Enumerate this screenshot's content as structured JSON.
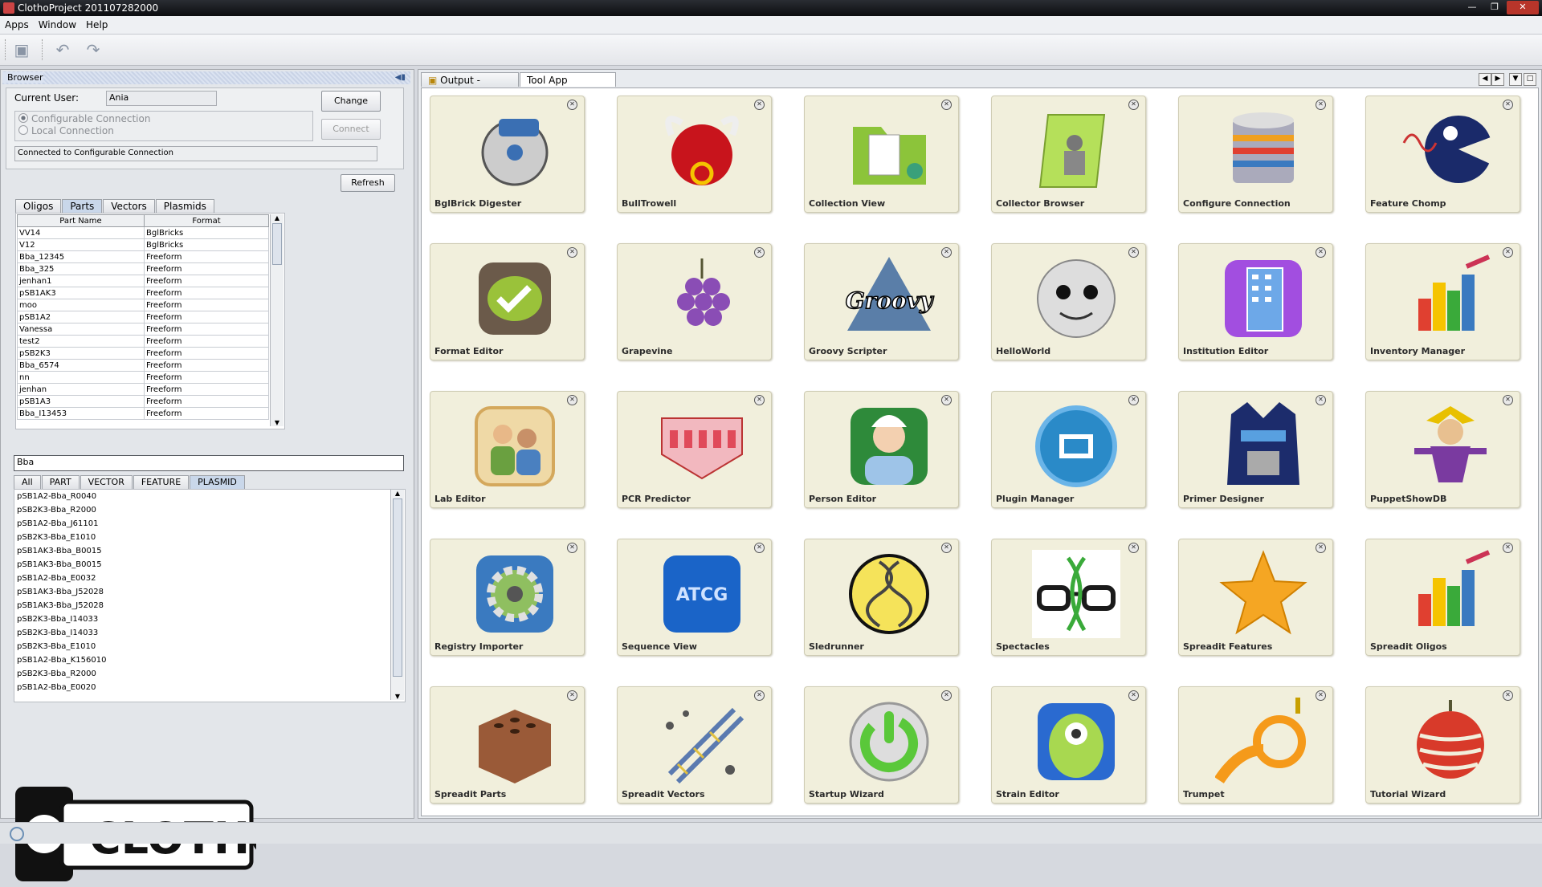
{
  "window": {
    "title": "ClothoProject 201107282000"
  },
  "menu": [
    "Apps",
    "Window",
    "Help"
  ],
  "browser": {
    "title": "Browser",
    "current_user_label": "Current User:",
    "current_user": "Ania",
    "change_label": "Change",
    "connect_label": "Connect",
    "radio_configurable": "Configurable Connection",
    "radio_local": "Local Connection",
    "status": "Connected to Configurable Connection",
    "refresh_label": "Refresh",
    "tabs": [
      "Oligos",
      "Parts",
      "Vectors",
      "Plasmids"
    ],
    "selected_tab": "Parts",
    "table": {
      "headers": [
        "Part Name",
        "Format"
      ],
      "rows": [
        [
          "VV14",
          "BglBricks"
        ],
        [
          "V12",
          "BglBricks"
        ],
        [
          "Bba_12345",
          "Freeform"
        ],
        [
          "Bba_325",
          "Freeform"
        ],
        [
          "jenhan1",
          "Freeform"
        ],
        [
          "pSB1AK3",
          "Freeform"
        ],
        [
          "moo",
          "Freeform"
        ],
        [
          "pSB1A2",
          "Freeform"
        ],
        [
          "Vanessa",
          "Freeform"
        ],
        [
          "test2",
          "Freeform"
        ],
        [
          "pSB2K3",
          "Freeform"
        ],
        [
          "Bba_6574",
          "Freeform"
        ],
        [
          "nn",
          "Freeform"
        ],
        [
          "jenhan",
          "Freeform"
        ],
        [
          "pSB1A3",
          "Freeform"
        ],
        [
          "Bba_I13453",
          "Freeform"
        ]
      ]
    },
    "search_value": "Bba",
    "filter_tabs": [
      "All",
      "PART",
      "VECTOR",
      "FEATURE",
      "PLASMID"
    ],
    "selected_filter": "PLASMID",
    "results": [
      "pSB1A2-Bba_R0040",
      "pSB2K3-Bba_R2000",
      "pSB1A2-Bba_J61101",
      "pSB2K3-Bba_E1010",
      "pSB1AK3-Bba_B0015",
      "pSB1AK3-Bba_B0015",
      "pSB1A2-Bba_E0032",
      "pSB1AK3-Bba_J52028",
      "pSB1AK3-Bba_J52028",
      "pSB2K3-Bba_I14033",
      "pSB2K3-Bba_I14033",
      "pSB2K3-Bba_E1010",
      "pSB1A2-Bba_K156010",
      "pSB2K3-Bba_R2000",
      "pSB1A2-Bba_E0020"
    ],
    "logo_text": "CLOTHO"
  },
  "doc_tabs": [
    {
      "label": "Output - out",
      "selected": false
    },
    {
      "label": "Tool App Browser",
      "selected": true
    }
  ],
  "apps": [
    {
      "name": "BglBrick Digester",
      "icon": "saw-icon",
      "color": "#3a6fb3"
    },
    {
      "name": "BullTrowell",
      "icon": "bull-icon",
      "color": "#c8141c"
    },
    {
      "name": "Collection View",
      "icon": "folder-icon",
      "color": "#8cc43a"
    },
    {
      "name": "Collector Browser",
      "icon": "collector-icon",
      "color": "#b5e05a"
    },
    {
      "name": "Configure Connection",
      "icon": "database-icon",
      "color": "#f0a020"
    },
    {
      "name": "Feature Chomp",
      "icon": "chomp-icon",
      "color": "#1a2a6a"
    },
    {
      "name": "Format Editor",
      "icon": "format-icon",
      "color": "#9ac23a"
    },
    {
      "name": "Grapevine",
      "icon": "grapes-icon",
      "color": "#8a4db5"
    },
    {
      "name": "Groovy Scripter",
      "icon": "groovy-icon",
      "color": "#4b6f94"
    },
    {
      "name": "HelloWorld",
      "icon": "globe-face-icon",
      "color": "#dddddd"
    },
    {
      "name": "Institution Editor",
      "icon": "building-icon",
      "color": "#a24ee0"
    },
    {
      "name": "Inventory Manager",
      "icon": "bar-cubes-icon",
      "color": "#e0402a"
    },
    {
      "name": "Lab Editor",
      "icon": "people-icon",
      "color": "#d4a85c"
    },
    {
      "name": "PCR Predictor",
      "icon": "pcr-tubes-icon",
      "color": "#e04a5a"
    },
    {
      "name": "Person Editor",
      "icon": "person-icon",
      "color": "#2e8a3a"
    },
    {
      "name": "Plugin Manager",
      "icon": "plugin-icon",
      "color": "#2a8ac8"
    },
    {
      "name": "Primer Designer",
      "icon": "robot-icon",
      "color": "#1c2c6c"
    },
    {
      "name": "PuppetShowDB",
      "icon": "puppet-icon",
      "color": "#7a3aa0"
    },
    {
      "name": "Registry Importer",
      "icon": "gear-icon",
      "color": "#3a7ac0"
    },
    {
      "name": "Sequence View",
      "icon": "atcg-icon",
      "color": "#1a64c8"
    },
    {
      "name": "Sledrunner",
      "icon": "dna-circle-icon",
      "color": "#f5e35a"
    },
    {
      "name": "Spectacles",
      "icon": "spectacles-icon",
      "color": "#1a1a1a"
    },
    {
      "name": "Spreadit Features",
      "icon": "star-icon",
      "color": "#f5a623"
    },
    {
      "name": "Spreadit Oligos",
      "icon": "bar-cubes-icon",
      "color": "#e0402a"
    },
    {
      "name": "Spreadit Parts",
      "icon": "brick-icon",
      "color": "#9a5a38"
    },
    {
      "name": "Spreadit Vectors",
      "icon": "dna-helix-icon",
      "color": "#5a7ab0"
    },
    {
      "name": "Startup Wizard",
      "icon": "power-icon",
      "color": "#5ac83a"
    },
    {
      "name": "Strain Editor",
      "icon": "monster-icon",
      "color": "#2a6ad0"
    },
    {
      "name": "Trumpet",
      "icon": "horn-icon",
      "color": "#f59a1a"
    },
    {
      "name": "Tutorial Wizard",
      "icon": "apple-icon",
      "color": "#d83a2a"
    }
  ]
}
